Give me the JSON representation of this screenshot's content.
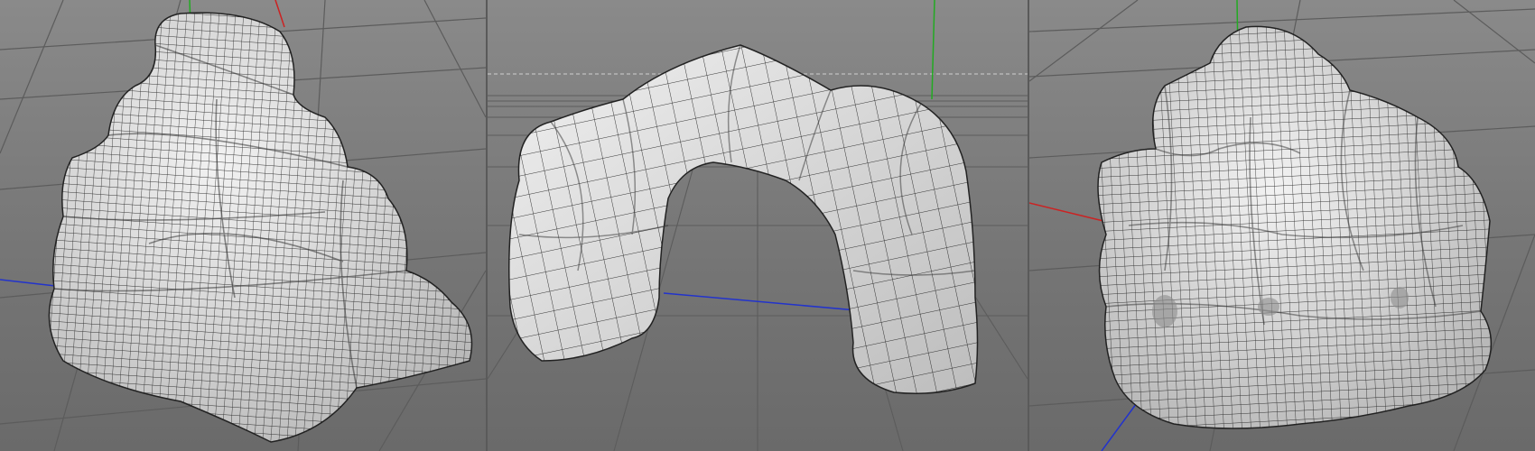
{
  "viewports": [
    {
      "name": "left",
      "object": "stacked-rock-mesh"
    },
    {
      "name": "middle",
      "object": "rock-arch-mesh"
    },
    {
      "name": "right",
      "object": "round-rock-mesh"
    }
  ],
  "colors": {
    "background": "#777777",
    "grid_line": "#5c5c5c",
    "mesh_fill": "#e6e6e6",
    "wire": "#1a1a1a",
    "axis_x": "#cc2222",
    "axis_y": "#22aa22",
    "axis_z": "#2233cc"
  }
}
